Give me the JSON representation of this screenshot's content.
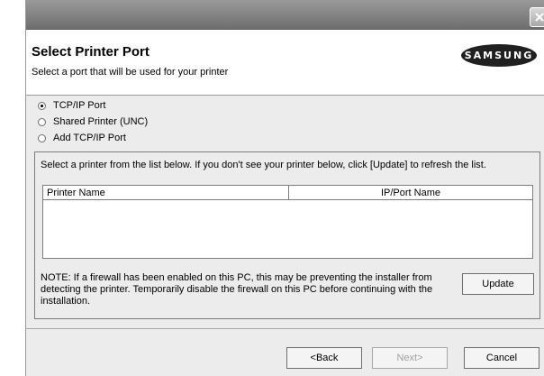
{
  "dialog": {
    "title": "Select Printer Port",
    "subtitle": "Select a port that will be used for your printer",
    "logo_text": "SAMSUNG"
  },
  "port_options": [
    {
      "label": "TCP/IP Port",
      "selected": true
    },
    {
      "label": "Shared Printer (UNC)",
      "selected": false
    },
    {
      "label": "Add TCP/IP Port",
      "selected": false
    }
  ],
  "printer_list": {
    "instruction": "Select a printer from the list below. If you don't see your printer below, click [Update] to refresh the list.",
    "columns": [
      "Printer Name",
      "IP/Port Name"
    ],
    "rows": []
  },
  "note": "NOTE: If a firewall has been enabled on this PC, this may be preventing the installer from detecting the printer. Temporarily disable the firewall on this PC before continuing with the installation.",
  "buttons": {
    "update": "Update",
    "back": "<Back",
    "next": "Next>",
    "cancel": "Cancel"
  },
  "icons": {
    "close": "close-icon"
  },
  "colors": {
    "titlebar": "#7e7e7e",
    "panel": "#ececec",
    "header_bg": "#ffffff",
    "logo_bg": "#202020"
  }
}
